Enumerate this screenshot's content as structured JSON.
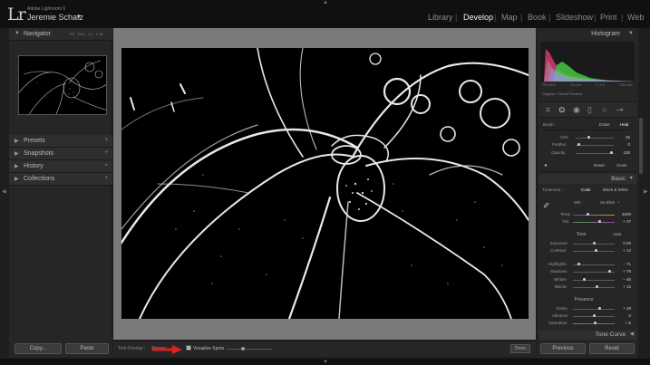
{
  "app": {
    "logo": "Lr",
    "name": "Adobe Lightroom 6",
    "user": "Jeremie Schatz",
    "user_caret": "▼"
  },
  "modules": [
    {
      "label": "Library"
    },
    {
      "label": "Develop"
    },
    {
      "label": "Map"
    },
    {
      "label": "Book"
    },
    {
      "label": "Slideshow"
    },
    {
      "label": "Print"
    },
    {
      "label": "Web"
    }
  ],
  "module_sep": "|",
  "left": {
    "navigator": {
      "title": "Navigator",
      "modes": "FIT  FILL  1:1  1:16"
    },
    "panels": [
      {
        "label": "Presets"
      },
      {
        "label": "Snapshots"
      },
      {
        "label": "History"
      },
      {
        "label": "Collections"
      }
    ],
    "copy_label": "Copy...",
    "paste_label": "Paste"
  },
  "right": {
    "histogram": {
      "title": "Histogram",
      "info": [
        "ISO 800",
        "24 mm",
        "f / 2.2",
        "1/60 sec"
      ],
      "preview_label": "Original + Smart Preview"
    },
    "brush": {
      "label": "Brush :",
      "modes": [
        "Erase",
        "Heal"
      ],
      "sliders": [
        {
          "label": "Size",
          "value": "25",
          "pos": 0.35
        },
        {
          "label": "Feather",
          "value": "0",
          "pos": 0.08
        },
        {
          "label": "Opacity",
          "value": "100",
          "pos": 0.95
        }
      ],
      "reset_label": "Reset",
      "close_label": "Close"
    },
    "basic": {
      "title": "Basic",
      "treatment_label": "Treatment :",
      "treatment_options": [
        "Color",
        "Black & White"
      ],
      "wb_label": "WB :",
      "wb_value": "As Shot",
      "temp": {
        "label": "Temp",
        "value": "4600",
        "pos": 0.35
      },
      "tint": {
        "label": "Tint",
        "value": "+ 37",
        "pos": 0.65
      },
      "tone_label": "Tone",
      "auto_label": "Auto",
      "tone_sliders": [
        {
          "label": "Exposure",
          "value": "0.00",
          "pos": 0.5
        },
        {
          "label": "Contrast",
          "value": "+ 12",
          "pos": 0.56
        }
      ],
      "tone_sliders2": [
        {
          "label": "Highlights",
          "value": "− 71",
          "pos": 0.15
        },
        {
          "label": "Shadows",
          "value": "+ 79",
          "pos": 0.88
        },
        {
          "label": "Whites",
          "value": "− 45",
          "pos": 0.28
        },
        {
          "label": "Blacks",
          "value": "+ 15",
          "pos": 0.58
        }
      ],
      "presence_label": "Presence",
      "presence_sliders": [
        {
          "label": "Clarity",
          "value": "+ 29",
          "pos": 0.65
        },
        {
          "label": "Vibrance",
          "value": "0",
          "pos": 0.5
        },
        {
          "label": "Saturation",
          "value": "+ 5",
          "pos": 0.53
        }
      ]
    },
    "tone_curve": {
      "title": "Tone Curve"
    },
    "previous_label": "Previous",
    "reset_label": "Reset"
  },
  "toolbar": {
    "tool_overlay_label": "Tool Overlay :",
    "tool_overlay_value": "Always",
    "visualize_label": "Visualize Spots",
    "visualize_checked": "✓",
    "visualize_pos": 0.35,
    "done_label": "Done"
  },
  "colors": {
    "red_arrow": "#e02020",
    "histo_red": "#c8366e",
    "histo_green": "#3fbf3f"
  }
}
